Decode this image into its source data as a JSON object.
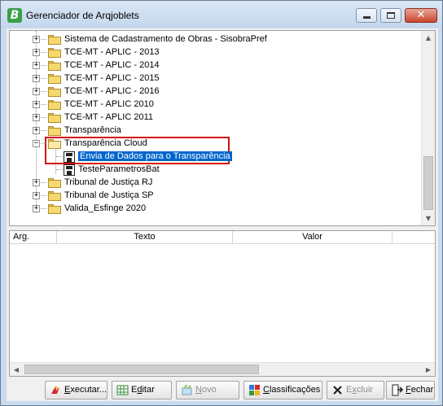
{
  "window": {
    "app_icon_letter": "B",
    "title": "Gerenciador de Arqjoblets",
    "close_glyph": "✕"
  },
  "tree": {
    "items": [
      {
        "label": "Sistema de Cadastramento de Obras - SisobraPref",
        "type": "folder",
        "expander": "+"
      },
      {
        "label": "TCE-MT - APLIC - 2013",
        "type": "folder",
        "expander": "+"
      },
      {
        "label": "TCE-MT - APLIC - 2014",
        "type": "folder",
        "expander": "+"
      },
      {
        "label": "TCE-MT - APLIC - 2015",
        "type": "folder",
        "expander": "+"
      },
      {
        "label": "TCE-MT - APLIC - 2016",
        "type": "folder",
        "expander": "+"
      },
      {
        "label": "TCE-MT - APLIC 2010",
        "type": "folder",
        "expander": "+"
      },
      {
        "label": "TCE-MT - APLIC 2011",
        "type": "folder",
        "expander": "+"
      },
      {
        "label": "Transparência",
        "type": "folder",
        "expander": "+"
      },
      {
        "label": "Transparência Cloud",
        "type": "folder-open",
        "expander": "−"
      },
      {
        "label": "Envia de Dados para o Transparência",
        "type": "job",
        "selected": true
      },
      {
        "label": "TesteParametrosBat",
        "type": "job"
      },
      {
        "label": "Tribunal de Justiça RJ",
        "type": "folder",
        "expander": "+"
      },
      {
        "label": "Tribunal de Justiça SP",
        "type": "folder",
        "expander": "+"
      },
      {
        "label": "Valida_Esfinge 2020",
        "type": "folder",
        "expander": "+"
      }
    ],
    "scroll_up": "▲",
    "scroll_down": "▼"
  },
  "grid": {
    "columns": [
      "Arg.",
      "Texto",
      "Valor"
    ],
    "scroll_left": "◀",
    "scroll_right": "▶"
  },
  "buttons": {
    "executar": {
      "accel": "E",
      "rest": "xecutar..."
    },
    "editar": {
      "pre": "E",
      "accel": "d",
      "rest": "itar"
    },
    "novo": {
      "accel": "N",
      "rest": "ovo",
      "disabled": true
    },
    "classificacoes": {
      "accel": "C",
      "rest": "lassificações"
    },
    "excluir": {
      "pre": "E",
      "accel": "x",
      "rest": "cluir",
      "disabled": true
    },
    "fechar": {
      "accel": "F",
      "rest": "echar"
    }
  },
  "colors": {
    "selection": "#0066cc",
    "highlight_border": "#d01010",
    "titlebar": "#c9dbee"
  }
}
